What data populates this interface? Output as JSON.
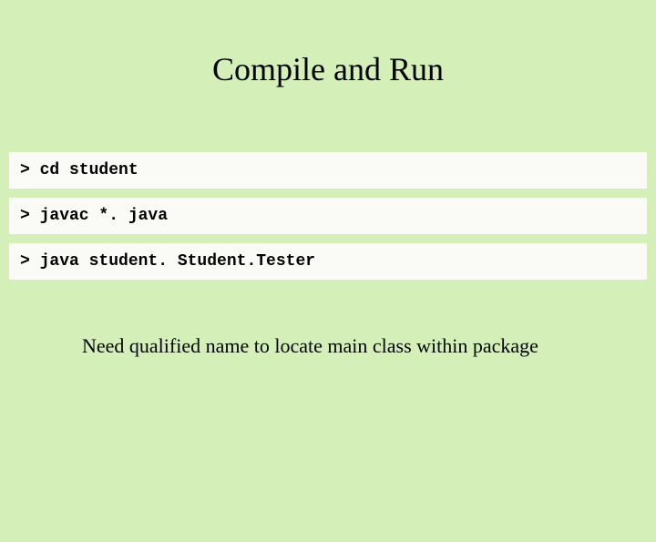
{
  "title": "Compile and Run",
  "commands": {
    "line1": "> cd student",
    "line2": "> javac *. java",
    "line3": "> java student. Student.Tester"
  },
  "note": "Need qualified name to locate main class within package"
}
